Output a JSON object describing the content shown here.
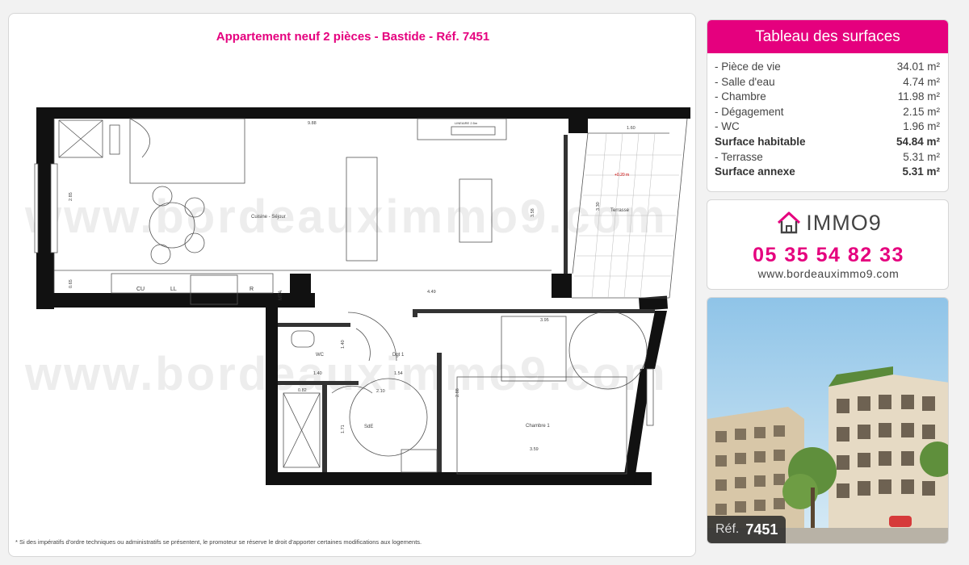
{
  "plan": {
    "title": "Appartement neuf 2 pièces - Bastide - Réf. 7451",
    "watermark": "www.bordeauximmo9.com",
    "disclaimer": "* Si des impératifs d'ordre techniques ou administratifs se présentent, le promoteur se réserve le droit d'apporter certaines modifications aux logements.",
    "room_labels": {
      "sejour": "Cuisine - Séjour",
      "terrasse": "Terrasse",
      "wc": "WC",
      "dgt": "Dgt 1",
      "sde": "SdE",
      "chambre": "Chambre 1"
    },
    "fixtures": {
      "cu": "CU",
      "ll": "LL",
      "r": "R",
      "mta": "MTA",
      "lineaire": "LINEAIRE 2.5m",
      "level": "+0.20 m"
    },
    "dimensions": {
      "d988": "9.88",
      "d160": "1.60",
      "d285": "2.85",
      "d358": "3.58",
      "d330": "3.30",
      "d065": "0.65",
      "d449": "4.49",
      "d395": "3.95",
      "d140a": "1.40",
      "d140b": "1.40",
      "d154": "1.54",
      "d082": "0.82",
      "d210": "2.10",
      "d171": "1.71",
      "d359": "3.59",
      "d288": "2.88"
    }
  },
  "surfaces": {
    "title": "Tableau des surfaces",
    "rows": [
      {
        "label": "- Pièce de vie",
        "value": "34.01 m²"
      },
      {
        "label": "- Salle d'eau",
        "value": "4.74 m²"
      },
      {
        "label": "- Chambre",
        "value": "11.98 m²"
      },
      {
        "label": "- Dégagement",
        "value": "2.15 m²"
      },
      {
        "label": "- WC",
        "value": "1.96 m²"
      },
      {
        "label": "Surface habitable",
        "value": "54.84 m²"
      },
      {
        "label": "- Terrasse",
        "value": "5.31 m²"
      },
      {
        "label": "Surface annexe",
        "value": "5.31 m²"
      }
    ]
  },
  "contact": {
    "logo": "IMMO9",
    "phone": "05 35 54 82 33",
    "website": "www.bordeauximmo9.com"
  },
  "photo": {
    "ref_label": "Réf.",
    "ref_number": "7451"
  },
  "colors": {
    "accent": "#e5007e"
  }
}
